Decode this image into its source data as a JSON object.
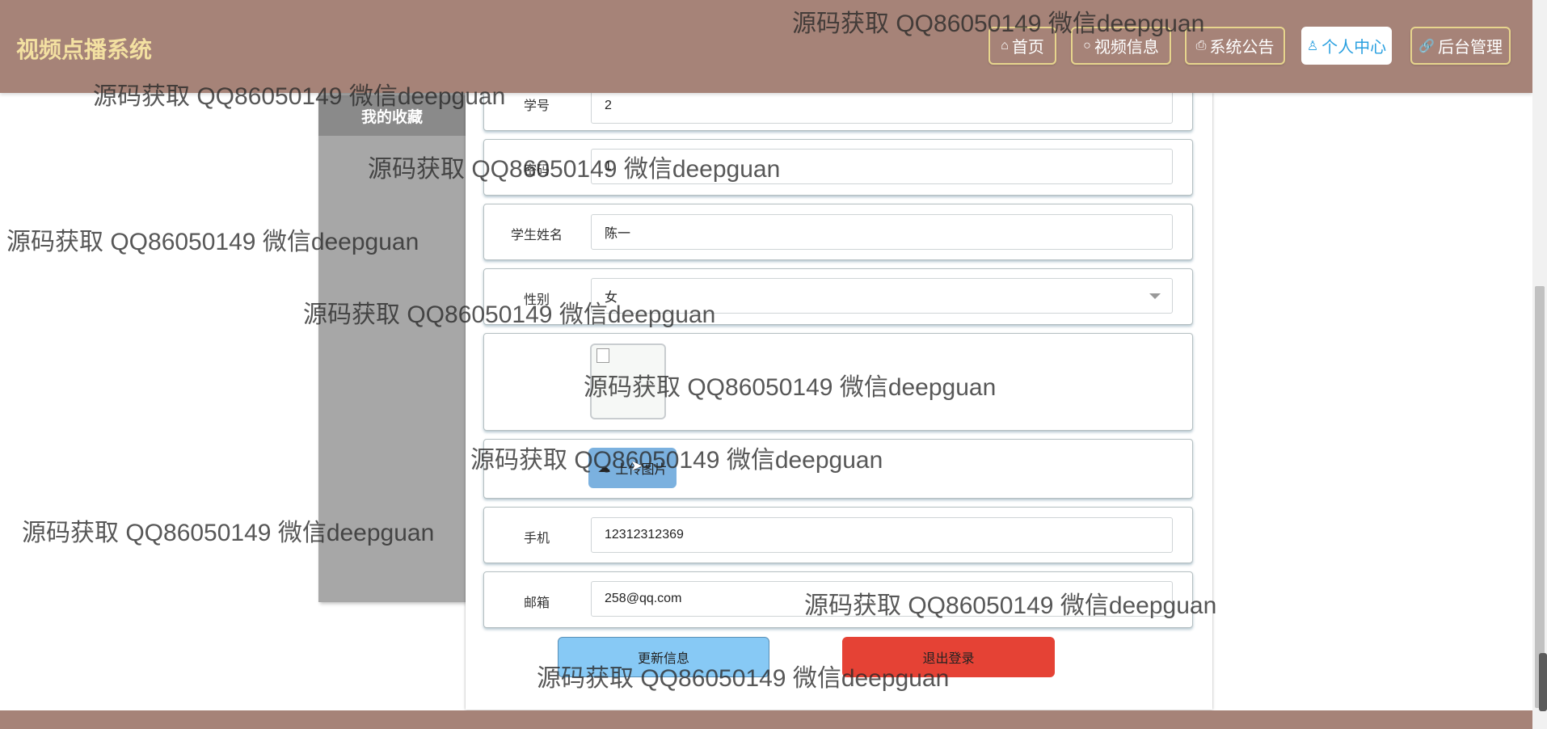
{
  "app": {
    "title": "视频点播系统"
  },
  "nav": {
    "items": [
      {
        "label": "首页",
        "icon": "home-icon"
      },
      {
        "label": "视频信息",
        "icon": "circle-icon"
      },
      {
        "label": "系统公告",
        "icon": "printer-icon"
      },
      {
        "label": "个人中心",
        "icon": "user-icon",
        "active": true
      },
      {
        "label": "后台管理",
        "icon": "link-icon"
      }
    ]
  },
  "sidebar": {
    "tab": "我的收藏"
  },
  "form": {
    "student_id": {
      "label": "学号",
      "value": "2"
    },
    "password": {
      "label": "密码",
      "value": "1"
    },
    "name": {
      "label": "学生姓名",
      "value": "陈一"
    },
    "gender": {
      "label": "性别",
      "value": "女"
    },
    "upload_label": "上传图片",
    "phone": {
      "label": "手机",
      "value": "12312312369"
    },
    "email": {
      "label": "邮箱",
      "value": "258@qq.com"
    },
    "update_button": "更新信息",
    "logout_button": "退出登录"
  },
  "watermark": "源码获取 QQ86050149 微信deepguan",
  "colors": {
    "topbar": "#a68378",
    "brand": "#f3e0a1",
    "accent": "#2aa0e0",
    "update": "#87c9f5",
    "logout": "#e54235"
  }
}
